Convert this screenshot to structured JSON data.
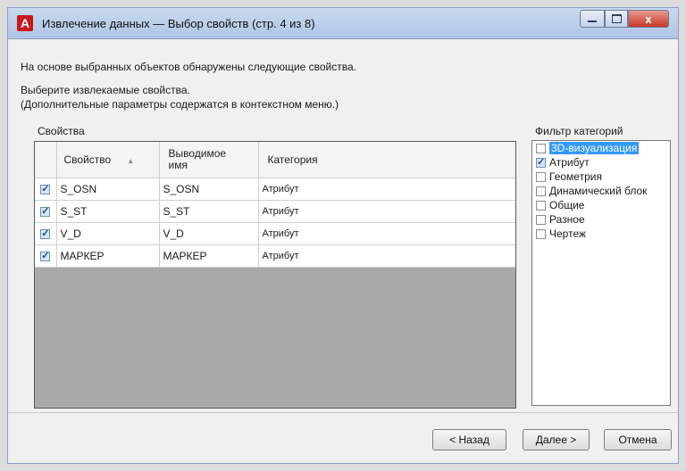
{
  "window": {
    "title": "Извлечение данных — Выбор свойств (стр. 4 из 8)",
    "app_icon_letter": "A",
    "close_glyph": "x"
  },
  "intro": {
    "line1": "На основе выбранных объектов обнаружены следующие свойства.",
    "line2": "Выберите извлекаемые свойства.",
    "line3": "(Дополнительные параметры содержатся в контекстном меню.)"
  },
  "properties": {
    "group_label": "Свойства",
    "columns": [
      "Свойство",
      "Выводимое имя",
      "Категория"
    ],
    "sort_arrow": "▲",
    "rows": [
      {
        "checked": true,
        "property": "S_OSN",
        "display_name": "S_OSN",
        "category": "Атрибут"
      },
      {
        "checked": true,
        "property": "S_ST",
        "display_name": "S_ST",
        "category": "Атрибут"
      },
      {
        "checked": true,
        "property": "V_D",
        "display_name": "V_D",
        "category": "Атрибут"
      },
      {
        "checked": true,
        "property": "МАРКЕР",
        "display_name": "МАРКЕР",
        "category": "Атрибут"
      }
    ]
  },
  "filter": {
    "label": "Фильтр категорий",
    "items": [
      {
        "label": "3D-визуализация",
        "checked": false,
        "selected": true
      },
      {
        "label": "Атрибут",
        "checked": true,
        "selected": false
      },
      {
        "label": "Геометрия",
        "checked": false,
        "selected": false
      },
      {
        "label": "Динамический блок",
        "checked": false,
        "selected": false
      },
      {
        "label": "Общие",
        "checked": false,
        "selected": false
      },
      {
        "label": "Разное",
        "checked": false,
        "selected": false
      },
      {
        "label": "Чертеж",
        "checked": false,
        "selected": false
      }
    ]
  },
  "buttons": {
    "back": "< Назад",
    "next": "Далее >",
    "cancel": "Отмена"
  }
}
